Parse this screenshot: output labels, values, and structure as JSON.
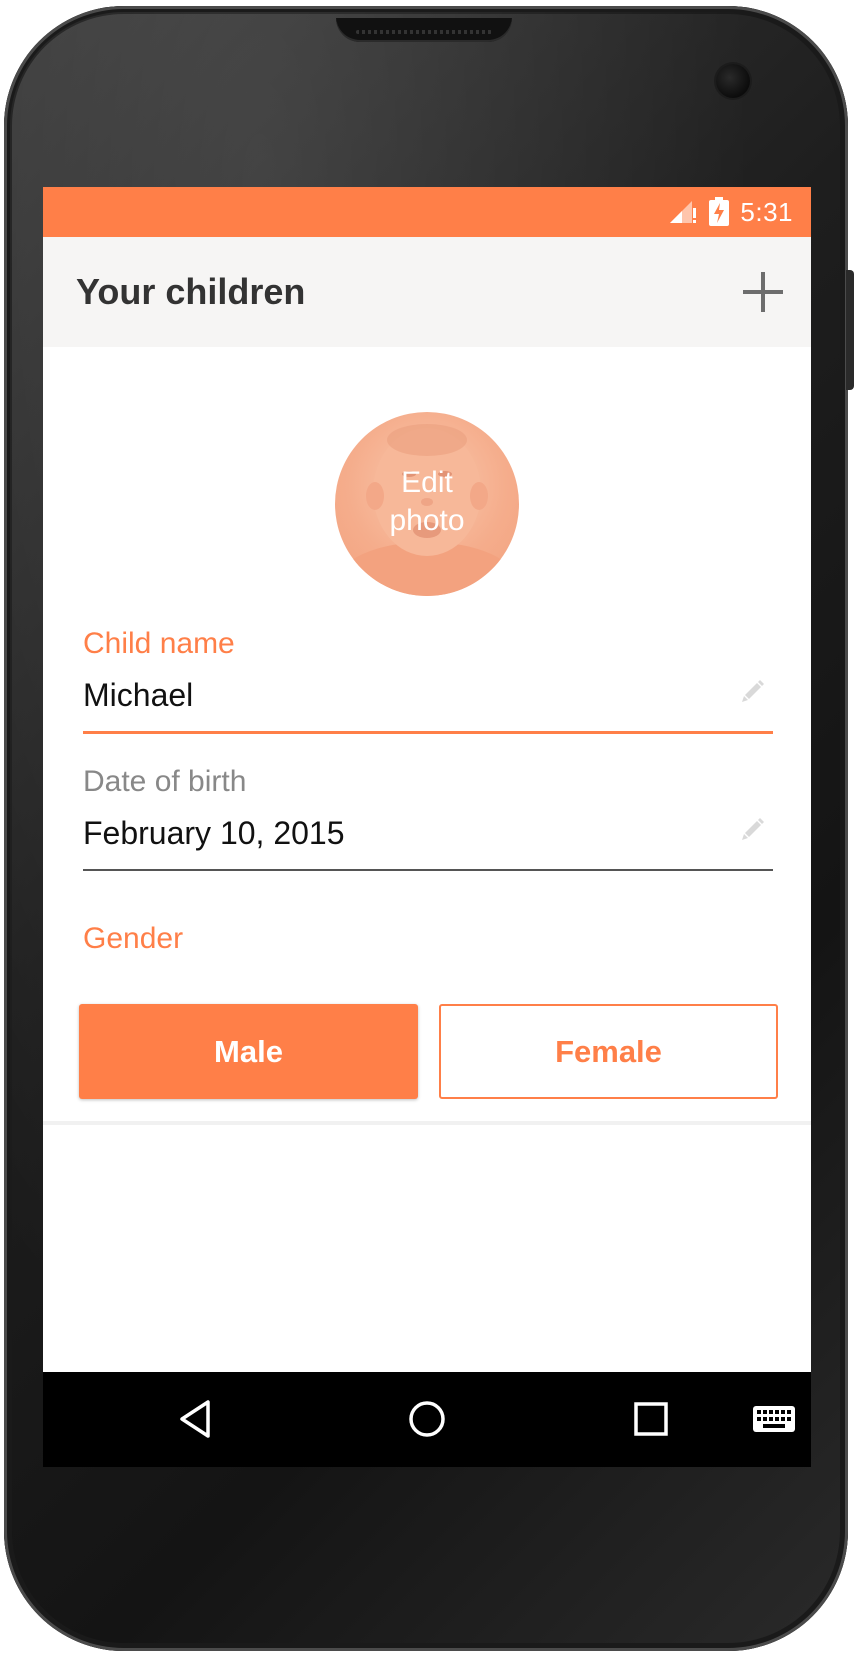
{
  "status_bar": {
    "time": "5:31",
    "signal_icon": "cell-signal-no-data-icon",
    "battery_icon": "battery-charging-icon",
    "background_color": "#ff7f48"
  },
  "app_bar": {
    "title": "Your children",
    "add_icon": "plus-icon"
  },
  "profile": {
    "photo_label": "Edit\nphoto"
  },
  "form": {
    "name": {
      "label": "Child name",
      "value": "Michael",
      "edit_icon": "pencil-icon",
      "focused": true
    },
    "birth": {
      "label": "Date of birth",
      "value": "February 10, 2015",
      "edit_icon": "pencil-icon",
      "focused": false
    },
    "gender": {
      "label": "Gender",
      "options": [
        "Male",
        "Female"
      ],
      "selected": "Male"
    }
  },
  "nav_bar": {
    "back_icon": "back-triangle-icon",
    "home_icon": "home-circle-icon",
    "recents_icon": "recents-square-icon",
    "keyboard_icon": "keyboard-icon"
  },
  "colors": {
    "accent": "#ff7f48",
    "text_primary": "#111111",
    "text_secondary": "#888888",
    "app_bar_bg": "#f6f5f4"
  }
}
